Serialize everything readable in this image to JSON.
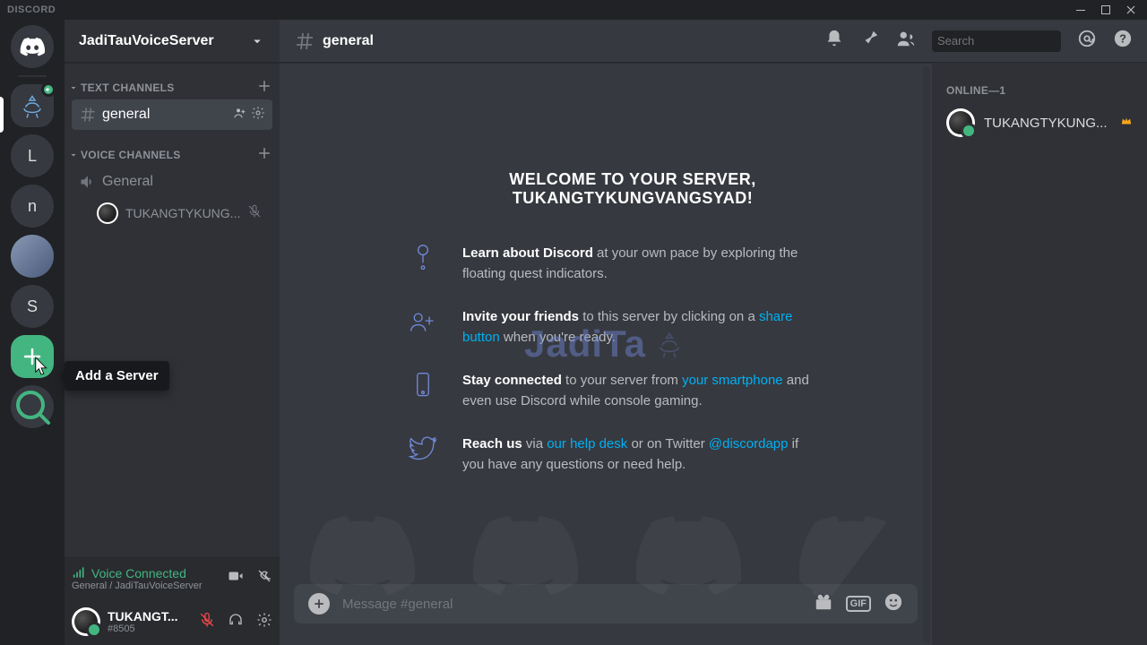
{
  "titlebar": {
    "brand": "DISCORD"
  },
  "servers": {
    "items": [
      {
        "kind": "home"
      },
      {
        "kind": "icon",
        "voice": true
      },
      {
        "kind": "letter",
        "label": "L"
      },
      {
        "kind": "letter",
        "label": "n"
      },
      {
        "kind": "photo"
      },
      {
        "kind": "letter",
        "label": "S"
      }
    ],
    "add_tooltip": "Add a Server"
  },
  "server_header": {
    "name": "JadiTauVoiceServer"
  },
  "channel_list": {
    "text_heading": "TEXT CHANNELS",
    "voice_heading": "VOICE CHANNELS",
    "text_channels": [
      {
        "name": "general",
        "selected": true
      }
    ],
    "voice_channels": [
      {
        "name": "General",
        "users": [
          {
            "name": "TUKANGTYKUNG...",
            "muted": true
          }
        ]
      }
    ]
  },
  "voice_panel": {
    "status": "Voice Connected",
    "sub": "General / JadiTauVoiceServer"
  },
  "user_panel": {
    "name": "TUKANGT...",
    "tag": "#8505"
  },
  "chat_header": {
    "channel": "general",
    "search_placeholder": "Search"
  },
  "welcome": {
    "title": "WELCOME TO YOUR SERVER, TUKANGTYKUNGVANGSYAD!",
    "items": [
      {
        "bold": "Learn about Discord",
        "rest": " at your own pace by exploring the floating quest indicators."
      },
      {
        "bold": "Invite your friends",
        "rest": " to this server by clicking on a ",
        "link": "share button",
        "rest2": " when you're ready."
      },
      {
        "bold": "Stay connected",
        "rest": " to your server from ",
        "link": "your smartphone",
        "rest2": " and even use Discord while console gaming."
      },
      {
        "bold": "Reach us",
        "rest": " via ",
        "link": "our help desk",
        "rest2": " or on Twitter ",
        "link2": "@discordapp",
        "rest3": " if you have any questions or need help."
      }
    ]
  },
  "message_input": {
    "placeholder": "Message #general",
    "gif_label": "GIF"
  },
  "members": {
    "heading": "ONLINE—1",
    "list": [
      {
        "name": "TUKANGTYKUNG...",
        "owner": true
      }
    ]
  },
  "watermark": {
    "text": "JadiTa"
  }
}
